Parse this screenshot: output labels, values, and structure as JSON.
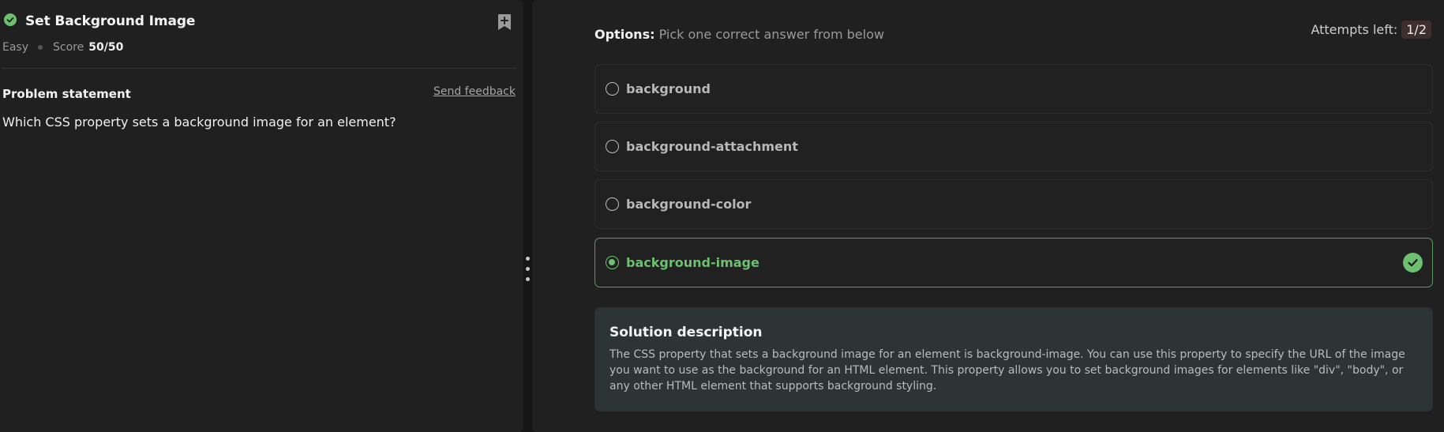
{
  "problem": {
    "title": "Set Background Image",
    "difficulty": "Easy",
    "score_label": "Score",
    "score_value": "50/50",
    "statement_heading": "Problem statement",
    "feedback_link": "Send feedback",
    "question": "Which CSS property sets a background image for an element?"
  },
  "options_panel": {
    "heading_bold": "Options:",
    "heading_text": " Pick one correct answer from below",
    "attempts_label": "Attempts left:",
    "attempts_value": "1/2",
    "options": [
      {
        "label": "background",
        "selected": false
      },
      {
        "label": "background-attachment",
        "selected": false
      },
      {
        "label": "background-color",
        "selected": false
      },
      {
        "label": "background-image",
        "selected": true,
        "correct": true
      }
    ]
  },
  "solution": {
    "heading": "Solution description",
    "text": "The CSS property that sets a background image for an element is background-image. You can use this property to specify the URL of the image you want to use as the background for an HTML element. This property allows you to set background images for elements like \"div\", \"body\", or any other HTML element that supports background styling."
  },
  "colors": {
    "accent_green": "#6cc070",
    "panel_bg": "#202020",
    "solution_bg": "#2d3436"
  },
  "icons": {
    "solved": "check-circle-icon",
    "bookmark": "bookmark-plus-icon",
    "correct": "check-circle-icon",
    "splitter": "drag-handle-icon"
  }
}
